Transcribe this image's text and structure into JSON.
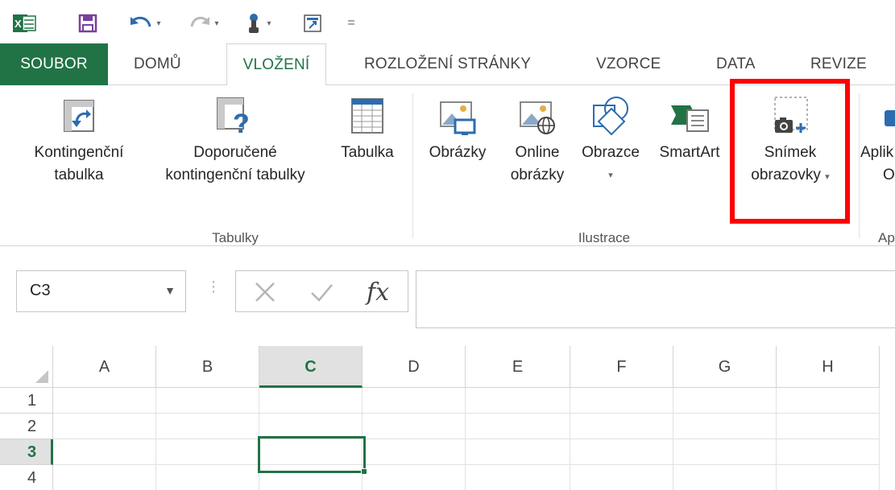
{
  "qat": {
    "icons": [
      "excel-logo-icon",
      "save-icon",
      "undo-icon",
      "redo-icon",
      "touch-mode-icon",
      "form-icon",
      "customize-qat-icon"
    ],
    "customize_label": "="
  },
  "tabs": [
    {
      "label": "SOUBOR"
    },
    {
      "label": "DOMŮ"
    },
    {
      "label": "VLOŽENÍ"
    },
    {
      "label": "ROZLOŽENÍ STRÁNKY"
    },
    {
      "label": "VZORCE"
    },
    {
      "label": "DATA"
    },
    {
      "label": "REVIZE"
    }
  ],
  "ribbon": {
    "tables": {
      "group_label": "Tabulky",
      "pivot": {
        "line1": "Kontingenční",
        "line2": "tabulka"
      },
      "recommended_pivot": {
        "line1": "Doporučené",
        "line2": "kontingenční tabulky"
      },
      "table": {
        "line1": "Tabulka"
      }
    },
    "illustrations": {
      "group_label": "Ilustrace",
      "pictures": {
        "line1": "Obrázky"
      },
      "online_pictures": {
        "line1": "Online",
        "line2": "obrázky"
      },
      "shapes": {
        "line1": "Obrazce"
      },
      "smartart": {
        "line1": "SmartArt"
      },
      "screenshot": {
        "line1": "Snímek",
        "line2": "obrazovky"
      }
    },
    "apps": {
      "line1": "Aplik",
      "line2": "O",
      "group_label": "Ap"
    }
  },
  "formula_bar": {
    "name_box_value": "C3",
    "fx_label": "fx",
    "formula_value": ""
  },
  "grid": {
    "columns": [
      "A",
      "B",
      "C",
      "D",
      "E",
      "F",
      "G",
      "H"
    ],
    "rows": [
      "1",
      "2",
      "3",
      "4"
    ],
    "selected_column": "C",
    "selected_row": "3"
  },
  "colors": {
    "accent": "#217346",
    "highlight": "#ff0000"
  }
}
